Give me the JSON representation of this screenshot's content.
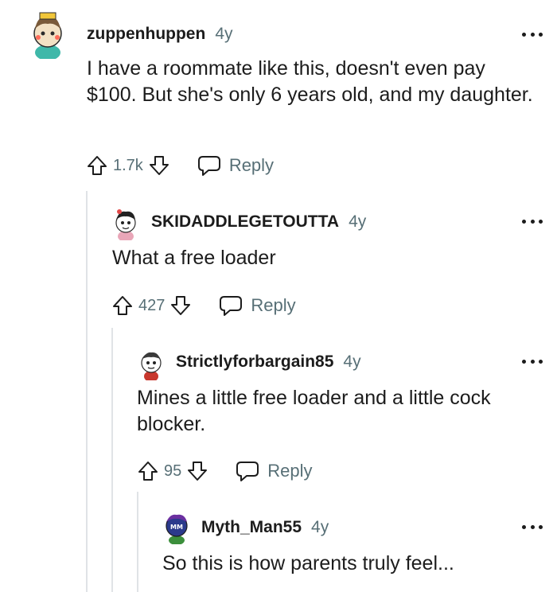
{
  "comments": [
    {
      "username": "zuppenhuppen",
      "age": "4y",
      "text": "I have a roommate like this, doesn't even pay $100. But she's only 6 years old, and my daughter.",
      "score": "1.7k",
      "reply_label": "Reply",
      "avatar_colors": {
        "face": "#f3e1c4",
        "hair": "#7a5a3a",
        "shirt": "#3fb8a9"
      }
    },
    {
      "username": "SKIDADDLEGETOUTTA",
      "age": "4y",
      "text": "What a free loader",
      "score": "427",
      "reply_label": "Reply",
      "avatar_colors": {
        "face": "#ffffff",
        "hair": "#222222",
        "shirt": "#e9a6b8"
      }
    },
    {
      "username": "Strictlyforbargain85",
      "age": "4y",
      "text": "Mines a little free loader and a little cock blocker.",
      "score": "95",
      "reply_label": "Reply",
      "avatar_colors": {
        "face": "#ffffff",
        "hair": "#3a3a3a",
        "shirt": "#c8372d"
      }
    },
    {
      "username": "Myth_Man55",
      "age": "4y",
      "text": "So this is how parents truly feel...",
      "avatar_colors": {
        "face": "#2b3a8c",
        "hair": "#6b2fa0",
        "shirt": "#3c8f3c"
      }
    }
  ],
  "icons": {
    "upvote": "upvote-arrow-icon",
    "downvote": "downvote-arrow-icon",
    "reply": "speech-bubble-icon",
    "more": "overflow-dots-icon"
  }
}
